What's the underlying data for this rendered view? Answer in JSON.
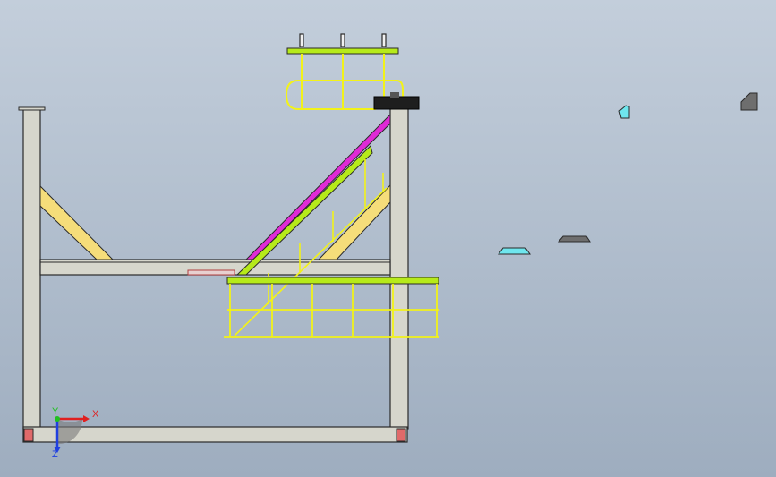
{
  "viewport": {
    "background_top": "#c3cedb",
    "background_bottom": "#9eadbf"
  },
  "colors": {
    "beam": "#d6d6cc",
    "beam_edge": "#2a2a2a",
    "brace": "#f5dd7a",
    "handrail": "#f2f219",
    "highlight_lime": "#b6ea1a",
    "highlight_magenta": "#e02ad6",
    "hidden_part_cyan": "#6fe6ee",
    "hidden_part_gray": "#6e6e6e",
    "grating_dark": "#1e1e1e",
    "base_plate_red": "#e06a6a",
    "axis_x": "#e02020",
    "axis_y": "#20c020",
    "axis_z": "#2040e0"
  },
  "triad": {
    "x_label": "X",
    "y_label": "Y",
    "z_label": "Z"
  }
}
